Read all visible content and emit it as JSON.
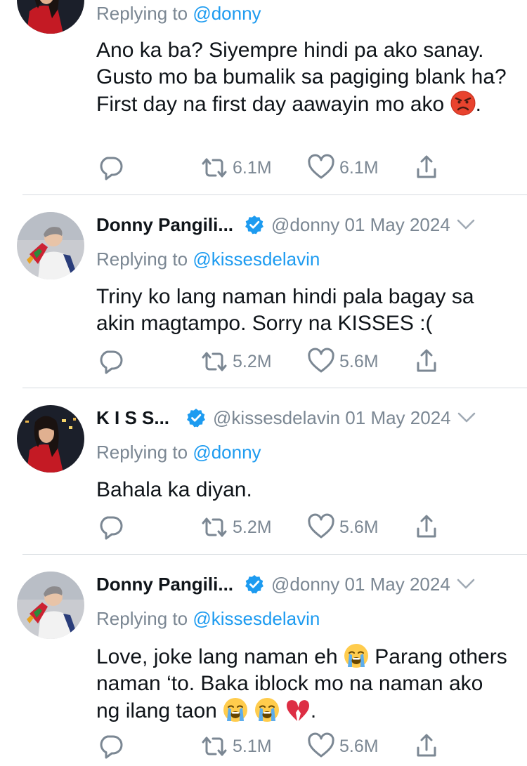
{
  "tweets": [
    {
      "replying_prefix": "Replying to",
      "replying_to": "@donny",
      "text": "Ano ka ba? Siyempre hindi pa ako sanay. Gusto mo ba bumalik sa pagiging blank ha? First day na first day aawayin mo ako",
      "text_end": ".",
      "retweets": "6.1M",
      "likes": "6.1M"
    },
    {
      "name": "Donny Pangili...",
      "handle": "@donny",
      "date": "01 May 2024",
      "replying_prefix": "Replying to",
      "replying_to": "@kissesdelavin",
      "text": "Triny ko lang naman hindi pala bagay sa akin magtampo. Sorry na KISSES :(",
      "retweets": "5.2M",
      "likes": "5.6M"
    },
    {
      "name": "K I S S...",
      "handle": "@kissesdelavin",
      "date": "01 May 2024",
      "replying_prefix": "Replying to",
      "replying_to": "@donny",
      "text": "Bahala ka diyan.",
      "retweets": "5.2M",
      "likes": "5.6M"
    },
    {
      "name": "Donny Pangili...",
      "handle": "@donny",
      "date": "01 May 2024",
      "replying_prefix": "Replying to",
      "replying_to": "@kissesdelavin",
      "text_a": "Love, joke lang naman eh",
      "text_b": " Parang others naman ‘to. Baka iblock mo na naman ako ng ilang taon",
      "text_end": ".",
      "retweets": "5.1M",
      "likes": "5.6M"
    }
  ],
  "colors": {
    "link": "#1d9bf0",
    "muted": "#7b8793",
    "verified": "#1d9bf0"
  },
  "icons": [
    "reply-icon",
    "retweet-icon",
    "like-icon",
    "share-icon",
    "verified-icon",
    "chevron-down-icon",
    "angry-face-emoji",
    "loudly-crying-face-emoji",
    "broken-heart-emoji"
  ]
}
